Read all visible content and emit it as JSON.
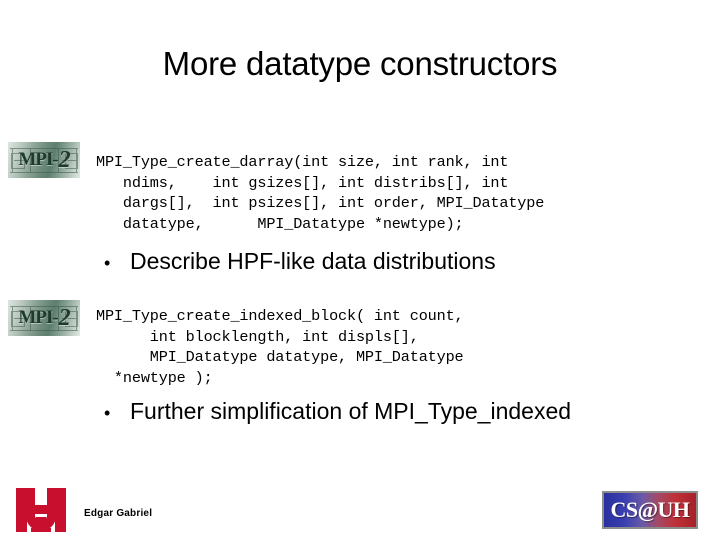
{
  "slide": {
    "title": "More datatype constructors",
    "background_color": "#ffffff",
    "text_color": "#000000"
  },
  "code_blocks": [
    {
      "id": "darray",
      "language": "c",
      "text": "MPI_Type_create_darray(int size, int rank, int\n   ndims,    int gsizes[], int distribs[], int\n   dargs[],  int psizes[], int order, MPI_Datatype\n   datatype,      MPI_Datatype *newtype);"
    },
    {
      "id": "indexed_block",
      "language": "c",
      "text": "MPI_Type_create_indexed_block( int count,\n      int blocklength, int displs[],\n      MPI_Datatype datatype, MPI_Datatype\n  *newtype );"
    }
  ],
  "bullets": [
    {
      "marker": "•",
      "text": "Describe HPF-like data distributions"
    },
    {
      "marker": "•",
      "text": "Further simplification of MPI_Type_indexed"
    }
  ],
  "logos": {
    "mpi2": {
      "wordmark_prefix": "MPI-",
      "wordmark_suffix": "2",
      "alt": "MPI-2",
      "color": "#1e3a2c"
    },
    "uh": {
      "alt": "UH",
      "color": "#c8102e"
    },
    "csuh": {
      "text": "CS@UH",
      "alt": "CS@UH",
      "color_left": "#2a2f9e",
      "color_right": "#bf3038",
      "text_color": "#ffffff"
    }
  },
  "footer": {
    "author": "Edgar Gabriel"
  }
}
